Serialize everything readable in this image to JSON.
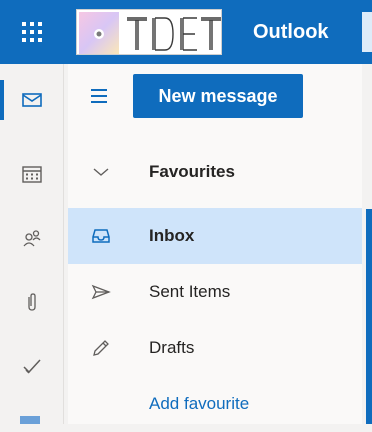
{
  "header": {
    "app_title": "Outlook",
    "logo_text": "TDET",
    "brand_color": "#0f6cbd"
  },
  "rail": {
    "items": [
      {
        "name": "mail",
        "icon": "mail-icon",
        "active": true
      },
      {
        "name": "calendar",
        "icon": "calendar-icon",
        "active": false
      },
      {
        "name": "people",
        "icon": "people-icon",
        "active": false
      },
      {
        "name": "files",
        "icon": "paperclip-icon",
        "active": false
      },
      {
        "name": "todo",
        "icon": "checkmark-icon",
        "active": false
      }
    ]
  },
  "toolbar": {
    "new_message_label": "New message"
  },
  "folders": {
    "favourites_label": "Favourites",
    "items": [
      {
        "label": "Inbox",
        "icon": "inbox-icon",
        "selected": true
      },
      {
        "label": "Sent Items",
        "icon": "send-icon",
        "selected": false
      },
      {
        "label": "Drafts",
        "icon": "pencil-icon",
        "selected": false
      }
    ],
    "add_favourite_label": "Add favourite"
  }
}
